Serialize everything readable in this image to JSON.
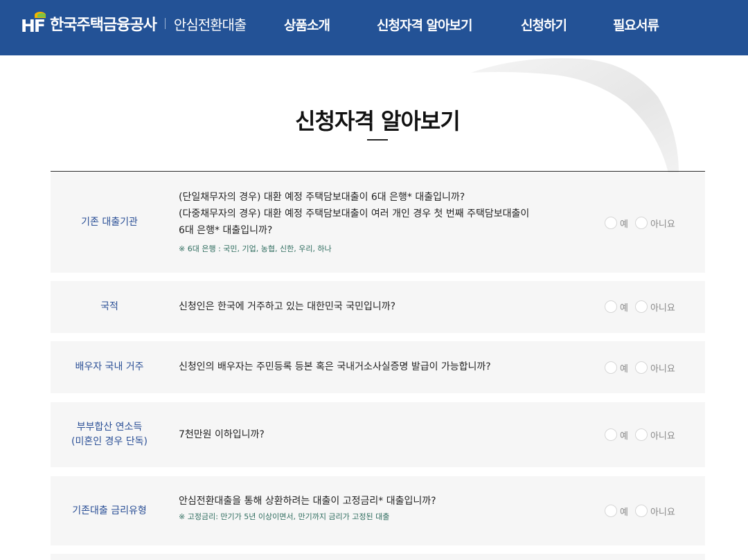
{
  "header": {
    "brand_mark": "HF",
    "brand_name": "한국주택금융공사",
    "brand_sub": "안심전환대출",
    "nav": [
      "상품소개",
      "신청자격 알아보기",
      "신청하기",
      "필요서류"
    ]
  },
  "page_title": "신청자격 알아보기",
  "options": {
    "yes": "예",
    "no": "아니요"
  },
  "rows": [
    {
      "category": "기존 대출기관",
      "lines": [
        "(단일채무자의 경우) 대환 예정 주택담보대출이 6대 은행* 대출입니까?",
        "(다중채무자의 경우) 대환 예정 주택담보대출이 여러 개인 경우 첫 번째 주택담보대출이",
        "6대 은행* 대출입니까?"
      ],
      "note": "※ 6대 은행 : 국민, 기업, 농협, 신한, 우리, 하나"
    },
    {
      "category": "국적",
      "lines": [
        "신청인은 한국에 거주하고 있는 대한민국 국민입니까?"
      ]
    },
    {
      "category": "배우자 국내 거주",
      "lines": [
        "신청인의 배우자는 주민등록 등본 혹은 국내거소사실증명 발급이 가능합니까?"
      ]
    },
    {
      "category_lines": [
        "부부합산 연소득",
        "(미혼인 경우 단독)"
      ],
      "lines": [
        "7천만원 이하입니까?"
      ]
    },
    {
      "category": "기존대출 금리유형",
      "lines": [
        "안심전환대출을 통해 상환하려는 대출이 고정금리* 대출입니까?"
      ],
      "note": "※ 고정금리: 만기가 5년 이상이면서, 만기까지 금리가 고정된 대출"
    }
  ]
}
